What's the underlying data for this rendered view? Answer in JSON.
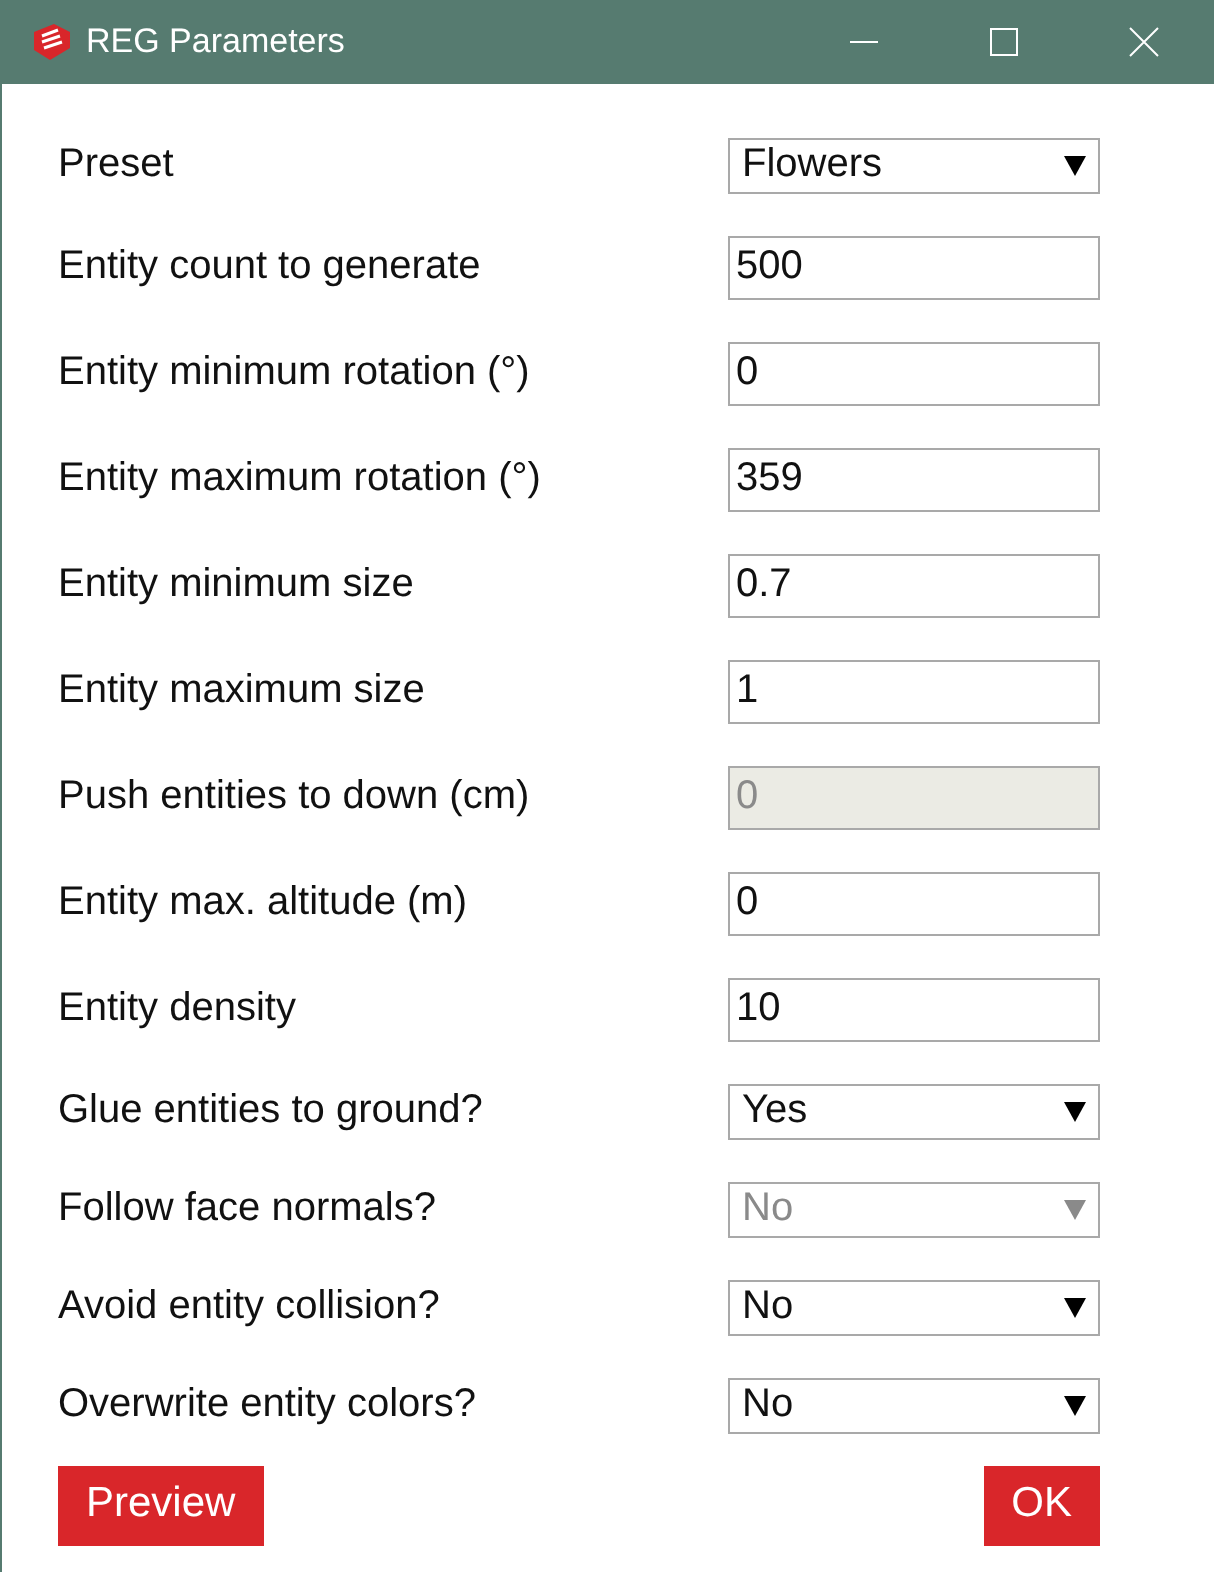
{
  "window": {
    "title": "REG Parameters"
  },
  "fields": [
    {
      "label": "Preset",
      "kind": "select",
      "value": "Flowers",
      "disabled": false
    },
    {
      "label": "Entity count to generate",
      "kind": "input",
      "value": "500",
      "disabled": false
    },
    {
      "label": "Entity minimum rotation (°)",
      "kind": "input",
      "value": "0",
      "disabled": false
    },
    {
      "label": "Entity maximum rotation (°)",
      "kind": "input",
      "value": "359",
      "disabled": false
    },
    {
      "label": "Entity minimum size",
      "kind": "input",
      "value": "0.7",
      "disabled": false
    },
    {
      "label": "Entity maximum size",
      "kind": "input",
      "value": "1",
      "disabled": false
    },
    {
      "label": "Push entities to down (cm)",
      "kind": "input",
      "value": "0",
      "disabled": true
    },
    {
      "label": "Entity max. altitude (m)",
      "kind": "input",
      "value": "0",
      "disabled": false
    },
    {
      "label": "Entity density",
      "kind": "input",
      "value": "10",
      "disabled": false
    },
    {
      "label": "Glue entities to ground?",
      "kind": "select",
      "value": "Yes",
      "disabled": false
    },
    {
      "label": "Follow face normals?",
      "kind": "select",
      "value": "No",
      "disabled": true
    },
    {
      "label": "Avoid entity collision?",
      "kind": "select",
      "value": "No",
      "disabled": false
    },
    {
      "label": "Overwrite entity colors?",
      "kind": "select",
      "value": "No",
      "disabled": false
    }
  ],
  "buttons": [
    {
      "label": "Preview"
    },
    {
      "label": "OK"
    }
  ]
}
